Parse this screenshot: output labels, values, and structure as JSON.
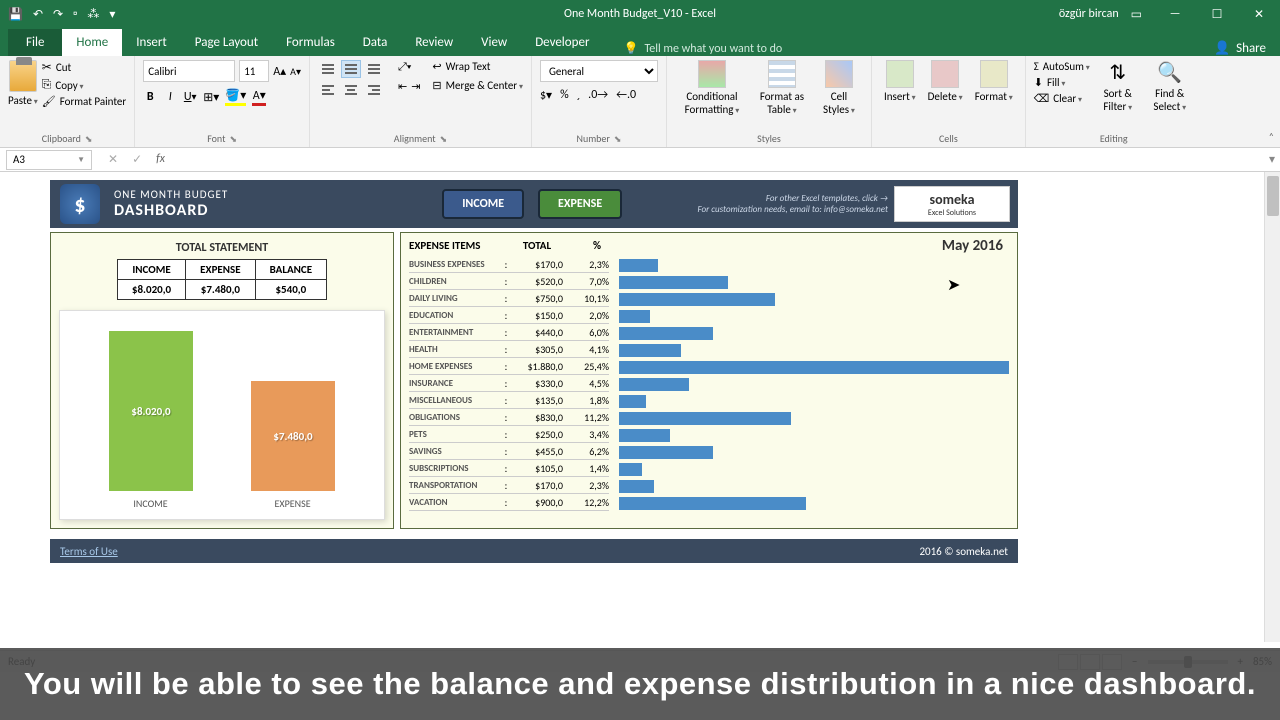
{
  "titlebar": {
    "doc_title": "One Month Budget_V10 - Excel",
    "user": "özgür bircan"
  },
  "ribbon_tabs": [
    "File",
    "Home",
    "Insert",
    "Page Layout",
    "Formulas",
    "Data",
    "Review",
    "View",
    "Developer"
  ],
  "tell_me": "Tell me what you want to do",
  "share": "Share",
  "clipboard": {
    "paste": "Paste",
    "cut": "Cut",
    "copy": "Copy",
    "painter": "Format Painter",
    "label": "Clipboard"
  },
  "font": {
    "name": "Calibri",
    "size": "11",
    "label": "Font"
  },
  "alignment": {
    "wrap": "Wrap Text",
    "merge": "Merge & Center",
    "label": "Alignment"
  },
  "number": {
    "format": "General",
    "label": "Number"
  },
  "styles": {
    "cond": "Conditional Formatting",
    "table": "Format as Table",
    "cell": "Cell Styles",
    "label": "Styles"
  },
  "cells": {
    "insert": "Insert",
    "delete": "Delete",
    "format": "Format",
    "label": "Cells"
  },
  "editing": {
    "sum": "AutoSum",
    "fill": "Fill",
    "clear": "Clear",
    "sort": "Sort & Filter",
    "find": "Find & Select",
    "label": "Editing"
  },
  "name_box": "A3",
  "dashboard": {
    "title1": "ONE MONTH BUDGET",
    "title2": "DASHBOARD",
    "btn_income": "INCOME",
    "btn_expense": "EXPENSE",
    "right1": "For other Excel templates, click →",
    "right2": "For customization needs, email to: info@someka.net",
    "someka1": "someka",
    "someka2": "Excel Solutions",
    "period": "May 2016",
    "stmt_title": "TOTAL STATEMENT",
    "stmt": {
      "h1": "INCOME",
      "h2": "EXPENSE",
      "h3": "BALANCE",
      "v1": "$8.020,0",
      "v2": "$7.480,0",
      "v3": "$540,0"
    },
    "bar_income": "$8.020,0",
    "bar_expense": "$7.480,0",
    "bar_lbl1": "INCOME",
    "bar_lbl2": "EXPENSE",
    "exp_hdr": {
      "c1": "EXPENSE ITEMS",
      "c2": "TOTAL",
      "c3": "%"
    },
    "expenses": [
      {
        "name": "BUSINESS EXPENSES",
        "total": "$170,0",
        "pct": "2,3%",
        "w": 10
      },
      {
        "name": "CHILDREN",
        "total": "$520,0",
        "pct": "7,0%",
        "w": 28
      },
      {
        "name": "DAILY LIVING",
        "total": "$750,0",
        "pct": "10,1%",
        "w": 40
      },
      {
        "name": "EDUCATION",
        "total": "$150,0",
        "pct": "2,0%",
        "w": 8
      },
      {
        "name": "ENTERTAINMENT",
        "total": "$440,0",
        "pct": "6,0%",
        "w": 24
      },
      {
        "name": "HEALTH",
        "total": "$305,0",
        "pct": "4,1%",
        "w": 16
      },
      {
        "name": "HOME EXPENSES",
        "total": "$1.880,0",
        "pct": "25,4%",
        "w": 100
      },
      {
        "name": "INSURANCE",
        "total": "$330,0",
        "pct": "4,5%",
        "w": 18
      },
      {
        "name": "MISCELLANEOUS",
        "total": "$135,0",
        "pct": "1,8%",
        "w": 7
      },
      {
        "name": "OBLIGATIONS",
        "total": "$830,0",
        "pct": "11,2%",
        "w": 44
      },
      {
        "name": "PETS",
        "total": "$250,0",
        "pct": "3,4%",
        "w": 13
      },
      {
        "name": "SAVINGS",
        "total": "$455,0",
        "pct": "6,2%",
        "w": 24
      },
      {
        "name": "SUBSCRIPTIONS",
        "total": "$105,0",
        "pct": "1,4%",
        "w": 6
      },
      {
        "name": "TRANSPORTATION",
        "total": "$170,0",
        "pct": "2,3%",
        "w": 9
      },
      {
        "name": "VACATION",
        "total": "$900,0",
        "pct": "12,2%",
        "w": 48
      }
    ],
    "terms": "Terms of Use",
    "copyright": "2016 © someka.net"
  },
  "chart_data": [
    {
      "type": "bar",
      "title": "TOTAL STATEMENT",
      "categories": [
        "INCOME",
        "EXPENSE"
      ],
      "values": [
        8020.0,
        7480.0
      ],
      "ylim": [
        0,
        8020
      ],
      "colors": [
        "#8bc34a",
        "#e89a5a"
      ]
    },
    {
      "type": "bar",
      "orientation": "horizontal",
      "title": "May 2016",
      "categories": [
        "BUSINESS EXPENSES",
        "CHILDREN",
        "DAILY LIVING",
        "EDUCATION",
        "ENTERTAINMENT",
        "HEALTH",
        "HOME EXPENSES",
        "INSURANCE",
        "MISCELLANEOUS",
        "OBLIGATIONS",
        "PETS",
        "SAVINGS",
        "SUBSCRIPTIONS",
        "TRANSPORTATION",
        "VACATION"
      ],
      "values": [
        170.0,
        520.0,
        750.0,
        150.0,
        440.0,
        305.0,
        1880.0,
        330.0,
        135.0,
        830.0,
        250.0,
        455.0,
        105.0,
        170.0,
        900.0
      ],
      "percentages": [
        2.3,
        7.0,
        10.1,
        2.0,
        6.0,
        4.1,
        25.4,
        4.5,
        1.8,
        11.2,
        3.4,
        6.2,
        1.4,
        2.3,
        12.2
      ],
      "xlim": [
        0,
        1880
      ],
      "color": "#4a8cc8"
    }
  ],
  "status": {
    "ready": "Ready",
    "zoom": "85%"
  },
  "caption": "You will be able to see the balance and expense distribution in a nice dashboard."
}
